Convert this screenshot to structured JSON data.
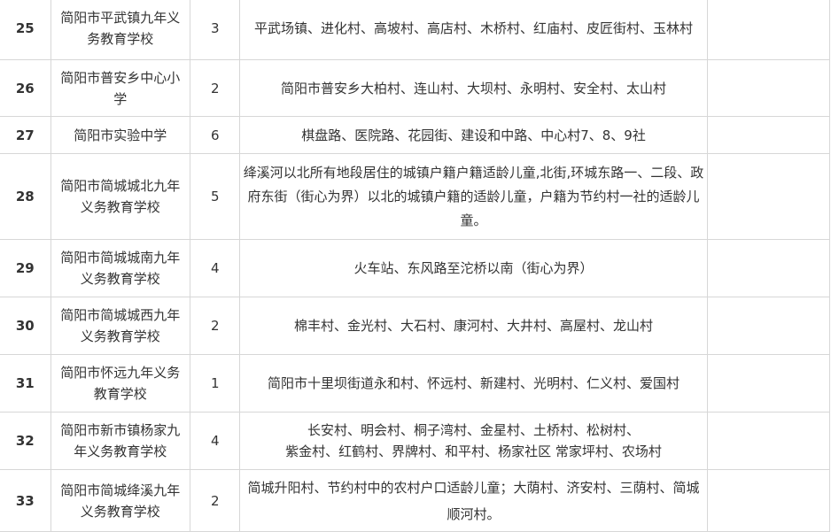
{
  "rows": [
    {
      "no": "25",
      "school": "简阳市平武镇九年义务教育学校",
      "classes": "3",
      "area": "平武场镇、进化村、高坡村、高店村、木桥村、红庙村、皮匠街村、玉林村"
    },
    {
      "no": "26",
      "school": "简阳市普安乡中心小学",
      "classes": "2",
      "area": "简阳市普安乡大柏村、连山村、大坝村、永明村、安全村、太山村"
    },
    {
      "no": "27",
      "school": "简阳市实验中学",
      "classes": "6",
      "area": "棋盘路、医院路、花园街、建设和中路、中心村7、8、9社"
    },
    {
      "no": "28",
      "school": "简阳市简城城北九年义务教育学校",
      "classes": "5",
      "area": "绛溪河以北所有地段居住的城镇户籍户籍适龄儿童,北街,环城东路一、二段、政府东街（街心为界）以北的城镇户籍的适龄儿童，户籍为节约村一社的适龄儿童。"
    },
    {
      "no": "29",
      "school": "简阳市简城城南九年义务教育学校",
      "classes": "4",
      "area": "火车站、东风路至沱桥以南（街心为界）"
    },
    {
      "no": "30",
      "school": "简阳市简城城西九年义务教育学校",
      "classes": "2",
      "area": "棉丰村、金光村、大石村、康河村、大井村、高屋村、龙山村"
    },
    {
      "no": "31",
      "school": "简阳市怀远九年义务教育学校",
      "classes": "1",
      "area": "简阳市十里坝街道永和村、怀远村、新建村、光明村、仁义村、爱国村"
    },
    {
      "no": "32",
      "school": "简阳市新市镇杨家九年义务教育学校",
      "classes": "4",
      "area_lines": [
        "长安村、明会村、桐子湾村、金星村、土桥村、松树村、",
        "紫金村、红鹤村、界牌村、和平村、杨家社区 常家坪村、农场村"
      ]
    },
    {
      "no": "33",
      "school": "简阳市简城绛溪九年义务教育学校",
      "classes": "2",
      "area": "简城升阳村、节约村中的农村户口适龄儿童；大荫村、济安村、三荫村、简城顺河村。"
    }
  ]
}
